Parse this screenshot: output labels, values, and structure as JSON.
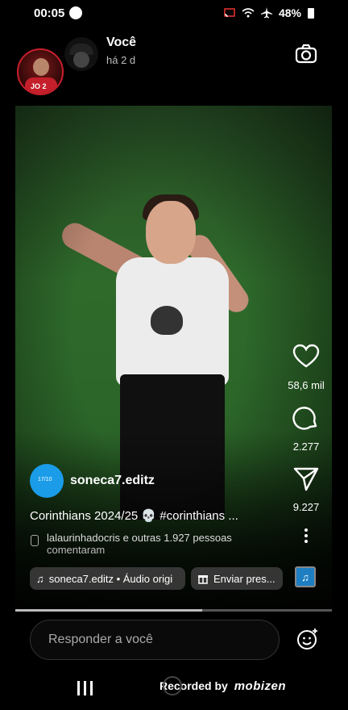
{
  "status_bar": {
    "time": "00:05",
    "battery": "48%"
  },
  "header": {
    "username": "Você",
    "time_ago": "há 2 d"
  },
  "actions": {
    "likes": "58,6 mil",
    "comments": "2.277",
    "shares": "9.227"
  },
  "post": {
    "author": "soneca7.editz",
    "author_avatar_text": "17/10",
    "caption": "Corinthians 2024/25 💀 #corinthians ...",
    "comments_line1": "lalaurinhadocris e outras 1.927 pessoas",
    "comments_line2": "comentaram",
    "audio_pill": "soneca7.editz • Áudio origi",
    "send_pill": "Enviar pres..."
  },
  "progress": 0.59,
  "reply": {
    "placeholder": "Responder a você"
  },
  "navbar": {
    "recorded": "Recorded by",
    "brand": "mobizen"
  },
  "colors": {
    "avatar_ring": "#c8202c",
    "author_avatar": "#1a9ce8",
    "music_button": "#1e7ec2"
  }
}
